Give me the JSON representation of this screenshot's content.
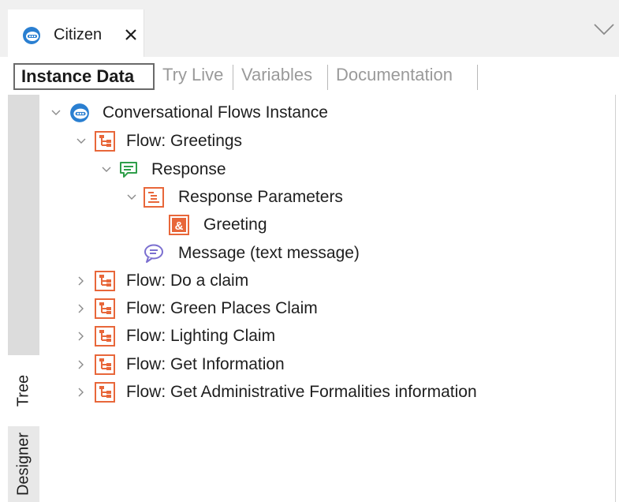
{
  "document_tab": {
    "label": "Citizen",
    "icon": "chat-bot-icon",
    "close_icon": "close-icon"
  },
  "overflow_icon": "chevron-down-icon",
  "sub_tabs": [
    {
      "label": "Instance Data",
      "active": true
    },
    {
      "label": "Try Live",
      "active": false
    },
    {
      "label": "Variables",
      "active": false
    },
    {
      "label": "Documentation",
      "active": false
    }
  ],
  "side_tabs": [
    {
      "label": "Tree",
      "active": true
    },
    {
      "label": "Designer",
      "active": false
    }
  ],
  "tree": [
    {
      "label": "Conversational Flows Instance",
      "icon": "chat-bot-icon",
      "expanded": true,
      "depth": 0
    },
    {
      "label": "Flow: Greetings",
      "icon": "flow-icon",
      "expanded": true,
      "depth": 1
    },
    {
      "label": "Response",
      "icon": "response-icon",
      "expanded": true,
      "depth": 2
    },
    {
      "label": "Response Parameters",
      "icon": "parameters-icon",
      "expanded": true,
      "depth": 3
    },
    {
      "label": "Greeting",
      "icon": "parameter-ampersand-icon",
      "depth": 4
    },
    {
      "label": "Message (text message)",
      "icon": "message-icon",
      "depth": 3
    },
    {
      "label": "Flow: Do a claim",
      "icon": "flow-icon",
      "expanded": false,
      "depth": 1
    },
    {
      "label": "Flow: Green Places Claim",
      "icon": "flow-icon",
      "expanded": false,
      "depth": 1
    },
    {
      "label": "Flow: Lighting Claim",
      "icon": "flow-icon",
      "expanded": false,
      "depth": 1
    },
    {
      "label": "Flow: Get Information",
      "icon": "flow-icon",
      "expanded": false,
      "depth": 1
    },
    {
      "label": "Flow: Get Administrative Formalities information",
      "icon": "flow-icon",
      "expanded": false,
      "depth": 1
    }
  ],
  "colors": {
    "flow_orange": "#e8673a",
    "response_green": "#2f9e4a",
    "message_purple": "#7b6fd0",
    "bot_blue": "#2a7fd1"
  }
}
